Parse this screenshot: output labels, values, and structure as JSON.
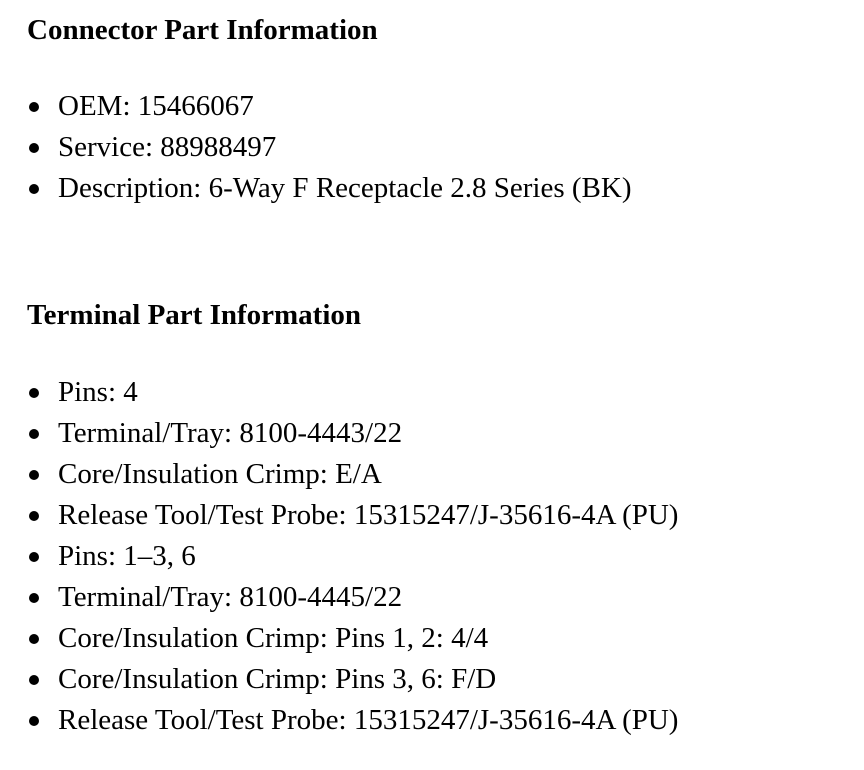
{
  "connector": {
    "heading": "Connector Part Information",
    "items": [
      "OEM: 15466067",
      "Service: 88988497",
      "Description: 6-Way F Receptacle 2.8 Series (BK)"
    ]
  },
  "terminal": {
    "heading": "Terminal Part Information",
    "items": [
      "Pins: 4",
      "Terminal/Tray: 8100-4443/22",
      "Core/Insulation Crimp: E/A",
      "Release Tool/Test Probe: 15315247/J-35616-4A (PU)",
      "Pins: 1–3, 6",
      "Terminal/Tray: 8100-4445/22",
      "Core/Insulation Crimp: Pins 1, 2: 4/4",
      "Core/Insulation Crimp: Pins 3, 6: F/D",
      "Release Tool/Test Probe: 15315247/J-35616-4A (PU)"
    ]
  }
}
